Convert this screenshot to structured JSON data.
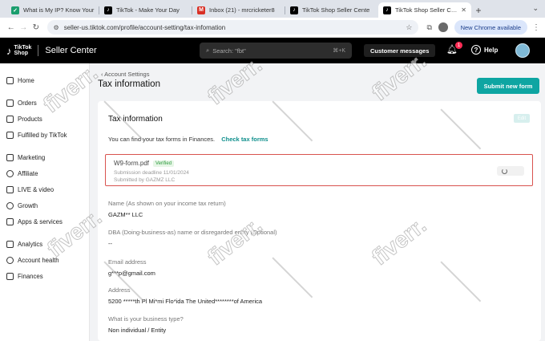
{
  "browser": {
    "tabs": [
      {
        "title": "What is My IP? Know Your",
        "icon": "shield-icon",
        "color": "#1b9e6e"
      },
      {
        "title": "TikTok - Make Your Day",
        "icon": "tiktok-icon",
        "color": "#000000"
      },
      {
        "title": "Inbox (21) - mrcricketer8",
        "icon": "gmail-icon",
        "color": "#d93025"
      },
      {
        "title": "TikTok Shop Seller Cente",
        "icon": "tiktok-icon",
        "color": "#000000"
      },
      {
        "title": "TikTok Shop Seller Cente",
        "icon": "tiktok-icon",
        "color": "#000000"
      }
    ],
    "url": "seller-us.tiktok.com/profile/account-setting/tax-infomation",
    "new_chrome_label": "New Chrome available"
  },
  "header": {
    "brand_line1": "TikTok",
    "brand_line2": "Shop",
    "app_name": "Seller Center",
    "search_placeholder": "Search: \"fbt\"",
    "search_shortcut": "⌘+K",
    "customer_messages": "Customer messages",
    "notification_count": "1",
    "help_label": "Help",
    "accent": "#fe2c55"
  },
  "sidebar": {
    "groups": [
      [
        {
          "label": "Home",
          "icon": "home-icon"
        }
      ],
      [
        {
          "label": "Orders",
          "icon": "orders-icon"
        },
        {
          "label": "Products",
          "icon": "products-icon"
        },
        {
          "label": "Fulfilled by TikTok",
          "icon": "box-icon"
        }
      ],
      [
        {
          "label": "Marketing",
          "icon": "marketing-icon"
        },
        {
          "label": "Affiliate",
          "icon": "affiliate-icon"
        },
        {
          "label": "LIVE & video",
          "icon": "live-icon"
        },
        {
          "label": "Growth",
          "icon": "growth-icon"
        },
        {
          "label": "Apps & services",
          "icon": "apps-icon"
        }
      ],
      [
        {
          "label": "Analytics",
          "icon": "analytics-icon"
        },
        {
          "label": "Account health",
          "icon": "health-icon"
        },
        {
          "label": "Finances",
          "icon": "finances-icon"
        }
      ]
    ]
  },
  "page": {
    "breadcrumb": "Account Settings",
    "title": "Tax information",
    "submit_button": "Submit new form",
    "accent": "#0ea5a2"
  },
  "card": {
    "title": "Tax information",
    "edit_label": "Edit",
    "info_text": "You can find your tax forms in Finances.",
    "info_link": "Check tax forms",
    "file": {
      "name": "W9-form.pdf",
      "status": "Verified",
      "submitted_on": "Submission deadline 11/01/2024",
      "submitted_by": "Submitted by GAZMZ LLC"
    },
    "fields": [
      {
        "label": "Name (As shown on your income tax return)",
        "value": "GAZM** LLC"
      },
      {
        "label": "DBA (Doing-business-as) name or disregarded entity (Optional)",
        "value": "--"
      },
      {
        "label": "Email address",
        "value": "g***p@gmail.com"
      },
      {
        "label": "Address",
        "value": "5200 *****th Pl Mi*mi Flo*ida The United********of America"
      },
      {
        "label": "What is your business type?",
        "value": "Non individual / Entity"
      }
    ]
  },
  "watermark": "fiverr."
}
